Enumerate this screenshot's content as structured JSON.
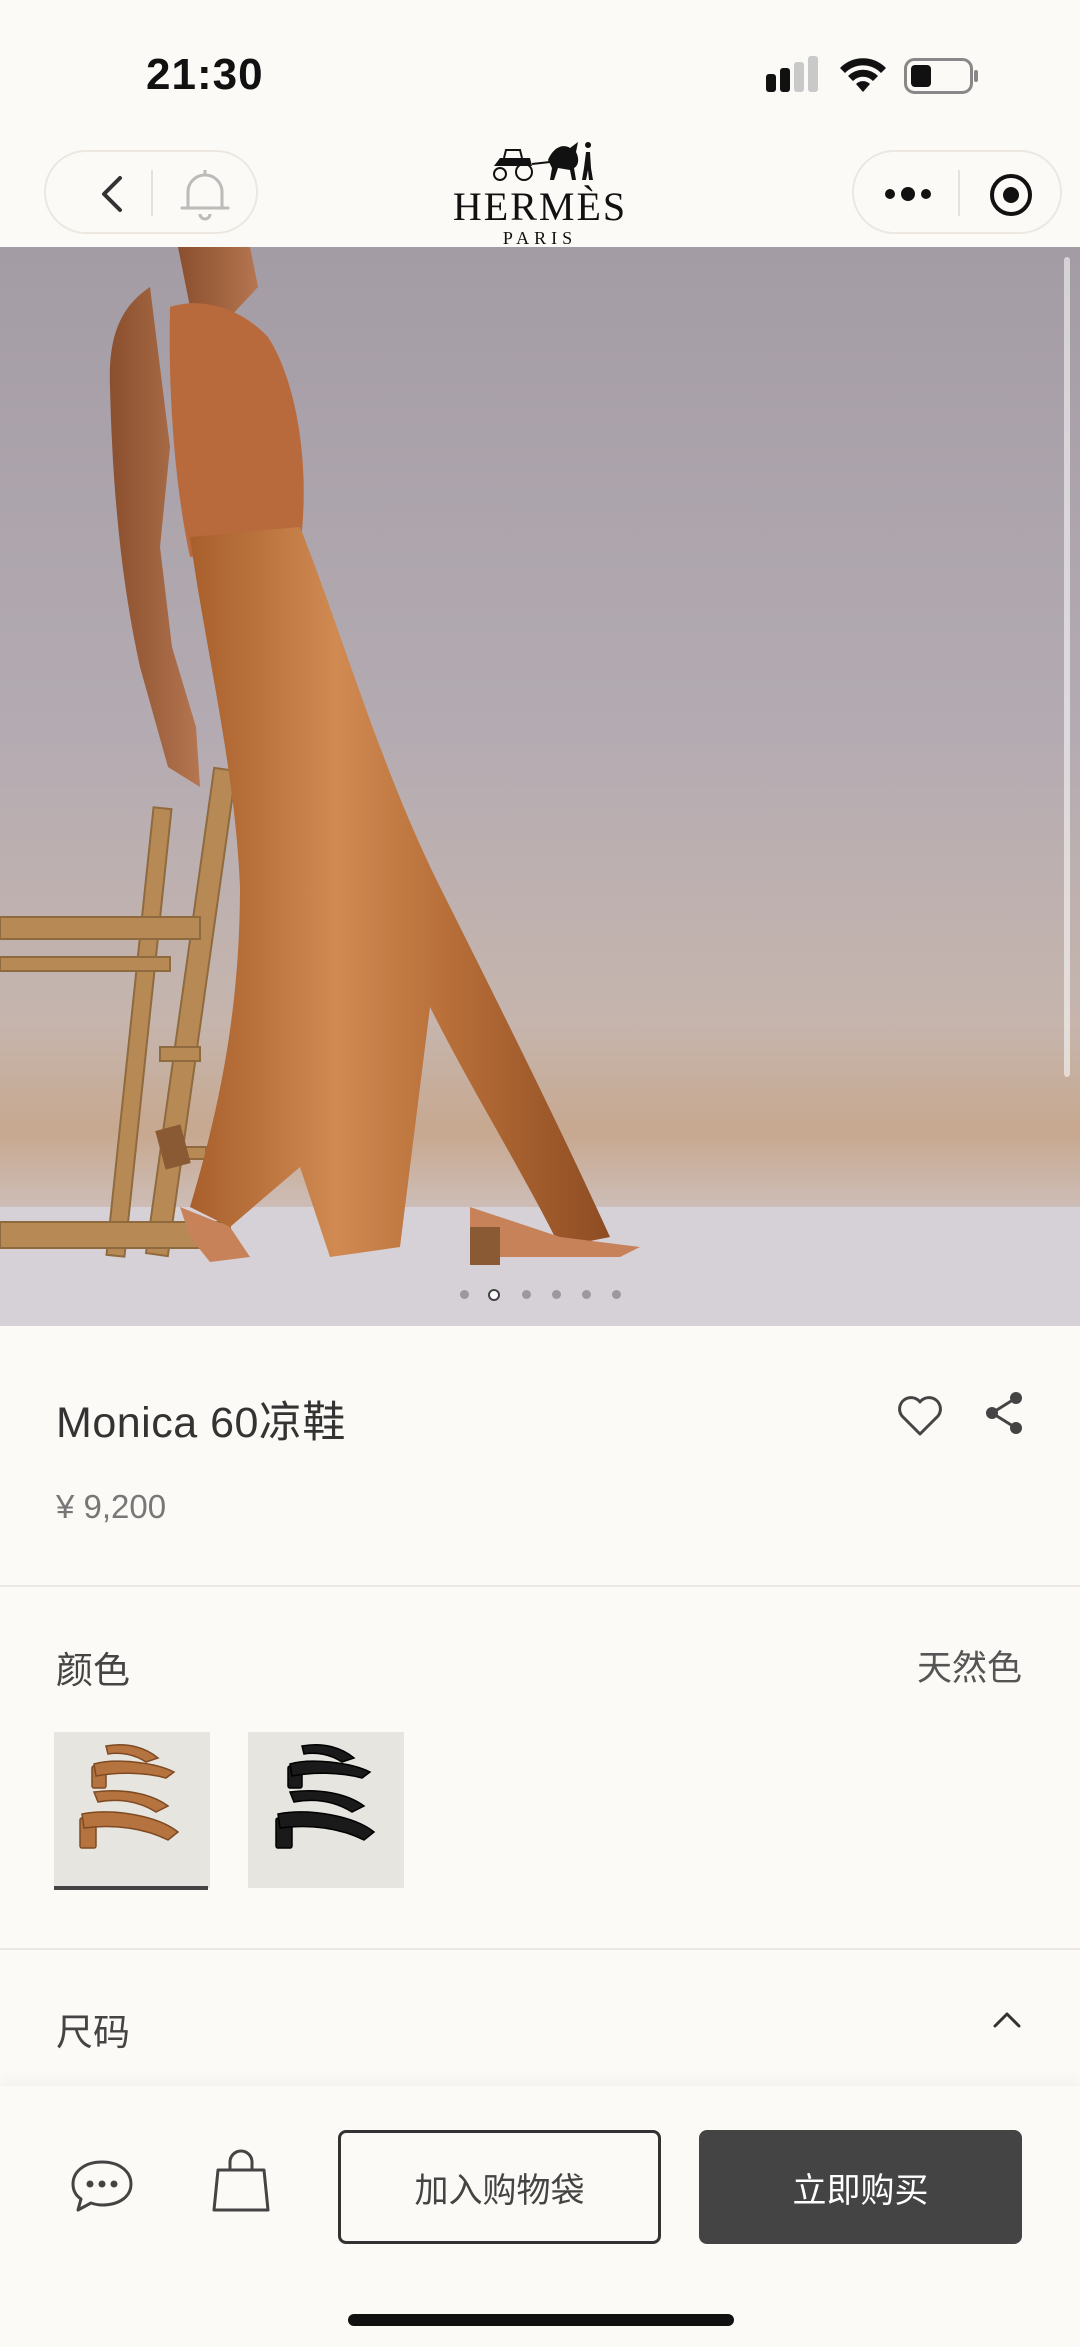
{
  "status_bar": {
    "time": "21:30"
  },
  "header": {
    "brand": "HERMÈS",
    "city": "PARIS"
  },
  "gallery": {
    "image_count": 6,
    "active_index": 1
  },
  "product": {
    "name": "Monica 60凉鞋",
    "price": "¥ 9,200"
  },
  "color": {
    "label": "颜色",
    "selected": "天然色",
    "swatches": [
      "natural-tan",
      "black"
    ]
  },
  "size": {
    "label": "尺码"
  },
  "actions": {
    "add_to_cart": "加入购物袋",
    "buy_now": "立即购买"
  },
  "colors": {
    "background": "#fcfaf6",
    "primary_button": "#444444",
    "tan": "#b5733f"
  }
}
